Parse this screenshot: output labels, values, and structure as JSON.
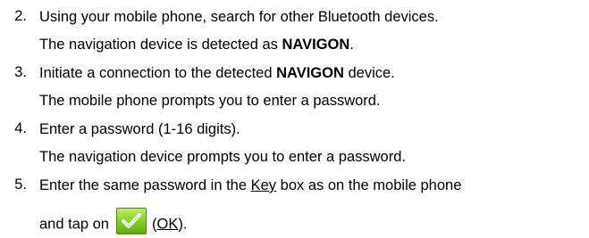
{
  "steps": [
    {
      "number": "2.",
      "line1": "Using your mobile phone, search for other Bluetooth devices.",
      "line2_pre": "The navigation device is detected as ",
      "line2_bold": "NAVIGON",
      "line2_post": "."
    },
    {
      "number": "3.",
      "line1_pre": "Initiate a connection to the detected ",
      "line1_bold": "NAVIGON",
      "line1_post": " device.",
      "line2": "The mobile phone prompts you to enter a password."
    },
    {
      "number": "4.",
      "line1": "Enter a password (1-16 digits).",
      "line2": "The navigation device prompts you to enter a password."
    },
    {
      "number": "5.",
      "line1_pre": "Enter the same password in the ",
      "line1_key": "Key",
      "line1_post": " box as on the mobile phone",
      "line2_pre": "and tap on",
      "line2_open": "(",
      "line2_ok": "OK",
      "line2_close": ")."
    }
  ],
  "icons": {
    "ok_button": "check-icon",
    "ok_color": "#6fbf1c"
  }
}
